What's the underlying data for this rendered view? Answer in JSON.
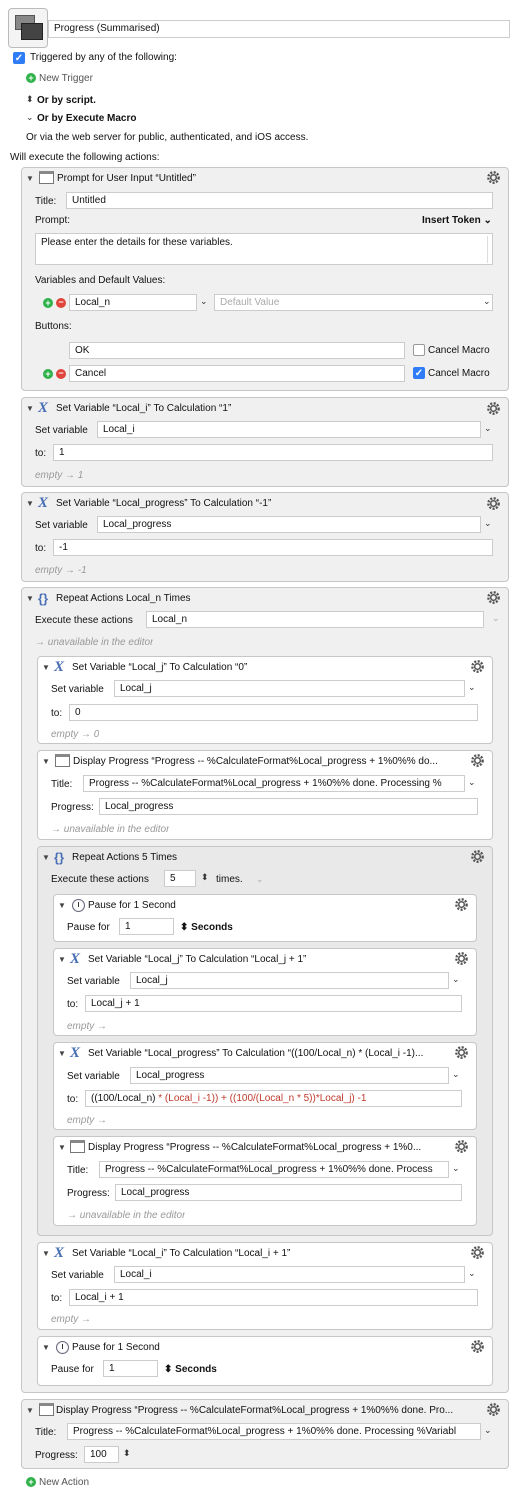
{
  "macro": {
    "name": "Progress (Summarised)"
  },
  "trigger": {
    "label": "Triggered by any of the following:",
    "new_trigger": "New Trigger",
    "or_script": "Or by script.",
    "or_execute": "Or by Execute Macro",
    "web_server": "Or via the web server for public, authenticated, and iOS access.",
    "will_execute": "Will execute the following actions:"
  },
  "prompt": {
    "header": "Prompt for User Input “Untitled”",
    "title_label": "Title:",
    "title_value": "Untitled",
    "prompt_label": "Prompt:",
    "insert_token": "Insert Token",
    "prompt_text": "Please enter the details for these variables.",
    "vars_label": "Variables and Default Values:",
    "var_name": "Local_n",
    "default_placeholder": "Default Value",
    "buttons_label": "Buttons:",
    "button1": "OK",
    "button2": "Cancel",
    "cancel_macro": "Cancel Macro"
  },
  "set_i": {
    "header": "Set Variable “Local_i” To Calculation “1”",
    "set_label": "Set variable",
    "var": "Local_i",
    "to_label": "to:",
    "value": "1",
    "status": "empty → 1"
  },
  "set_progress": {
    "header": "Set Variable “Local_progress” To Calculation “-1”",
    "set_label": "Set variable",
    "var": "Local_progress",
    "to_label": "to:",
    "value": "-1",
    "status": "empty → -1"
  },
  "repeat_outer": {
    "header": "Repeat Actions Local_n Times",
    "exec_label": "Execute these actions",
    "count": "Local_n",
    "status": "→ unavailable in the editor"
  },
  "set_j0": {
    "header": "Set Variable “Local_j” To Calculation “0”",
    "set_label": "Set variable",
    "var": "Local_j",
    "to_label": "to:",
    "value": "0",
    "status": "empty → 0"
  },
  "display1": {
    "header": "Display Progress “Progress -- %CalculateFormat%Local_progress + 1%0%% do...",
    "title_label": "Title:",
    "title_value": "Progress -- %CalculateFormat%Local_progress + 1%0%% done. Processing %",
    "progress_label": "Progress:",
    "progress_value": "Local_progress",
    "status": "→ unavailable in the editor"
  },
  "repeat_inner": {
    "header": "Repeat Actions 5 Times",
    "exec_label": "Execute these actions",
    "count": "5",
    "times": "times."
  },
  "pause1": {
    "header": "Pause for 1 Second",
    "label": "Pause for",
    "value": "1",
    "unit": "Seconds"
  },
  "set_j": {
    "header": "Set Variable “Local_j” To Calculation “Local_j + 1”",
    "set_label": "Set variable",
    "var": "Local_j",
    "to_label": "to:",
    "value": "Local_j + 1",
    "status": "empty →"
  },
  "set_calc": {
    "header": "Set Variable “Local_progress” To Calculation “((100/Local_n) * (Local_i -1)...",
    "set_label": "Set variable",
    "var": "Local_progress",
    "to_label": "to:",
    "value_a": "((100/Local_n)",
    "value_b": " * (Local_i -1)) + ((100/(Local_n * 5))*Local_j) -1",
    "status": "empty →"
  },
  "display2": {
    "header": "Display Progress “Progress -- %CalculateFormat%Local_progress + 1%0...",
    "title_label": "Title:",
    "title_value": "Progress -- %CalculateFormat%Local_progress + 1%0%% done. Process",
    "progress_label": "Progress:",
    "progress_value": "Local_progress",
    "status": "→ unavailable in the editor"
  },
  "set_i2": {
    "header": "Set Variable “Local_i” To Calculation “Local_i + 1”",
    "set_label": "Set variable",
    "var": "Local_i",
    "to_label": "to:",
    "value": "Local_i + 1",
    "status": "empty →"
  },
  "pause2": {
    "header": "Pause for 1 Second",
    "label": "Pause for",
    "value": "1",
    "unit": "Seconds"
  },
  "display3": {
    "header": "Display Progress “Progress -- %CalculateFormat%Local_progress + 1%0%% done. Pro...",
    "title_label": "Title:",
    "title_value": "Progress -- %CalculateFormat%Local_progress + 1%0%% done. Processing %Variabl",
    "progress_label": "Progress:",
    "progress_value": "100"
  },
  "new_action": "New Action",
  "icons": {
    "gear": "gear-icon",
    "calc": "variable-x-icon",
    "repeat": "braces-icon",
    "window": "window-icon",
    "pause": "clock-icon"
  },
  "colors": {
    "accent": "#2f7df6",
    "icon_blue": "#4a6fb5",
    "add": "#2fb24a",
    "remove": "#e0443a",
    "calc_red": "#c0392b"
  }
}
